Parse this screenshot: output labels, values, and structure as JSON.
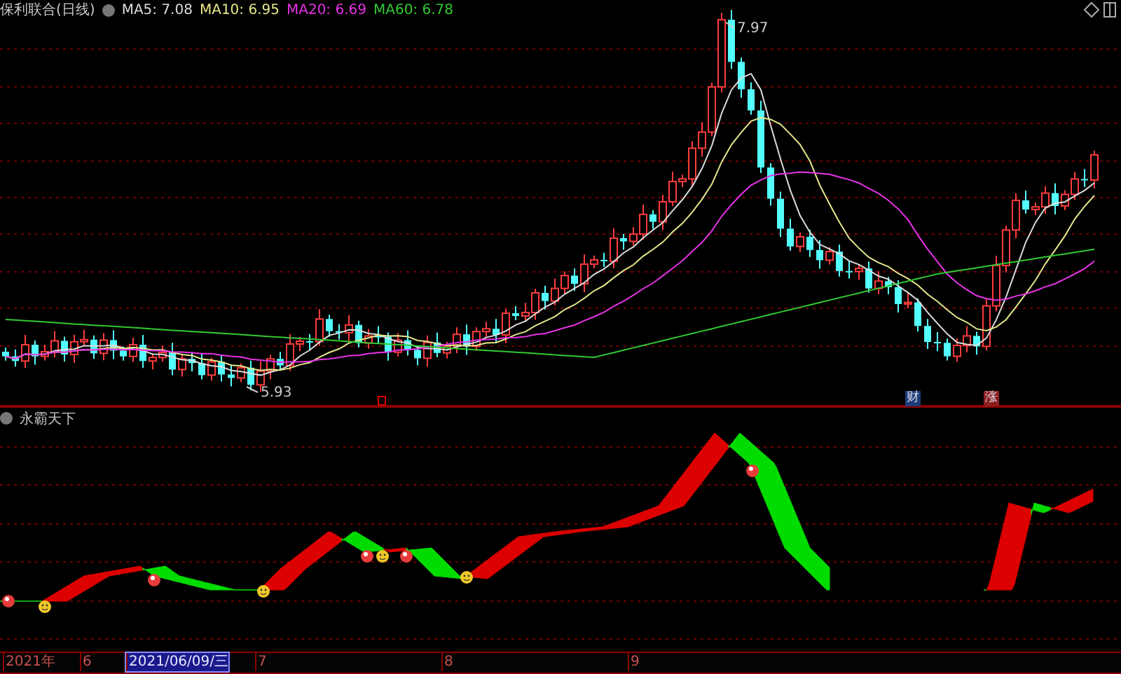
{
  "main_chart": {
    "title": "保利联合(日线)",
    "indicators": [
      {
        "label": "MA5: 7.08",
        "color": "#dcdcdc"
      },
      {
        "label": "MA10: 6.95",
        "color": "#e6e68c"
      },
      {
        "label": "MA20: 6.69",
        "color": "#e632e6"
      },
      {
        "label": "MA60: 6.78",
        "color": "#32c832"
      }
    ],
    "high_label": "7.97",
    "low_label": "5.93",
    "event_markers": [
      {
        "text": "财",
        "kind": "finance"
      },
      {
        "text": "涨",
        "kind": "rise"
      }
    ]
  },
  "sub_chart": {
    "title": "永霸天下"
  },
  "time_axis": [
    {
      "label": "2021年",
      "selected": false
    },
    {
      "label": "6",
      "selected": false
    },
    {
      "label": "2021/06/09/三",
      "selected": true
    },
    {
      "label": "7",
      "selected": false
    },
    {
      "label": "8",
      "selected": false
    },
    {
      "label": "9",
      "selected": false
    }
  ]
}
